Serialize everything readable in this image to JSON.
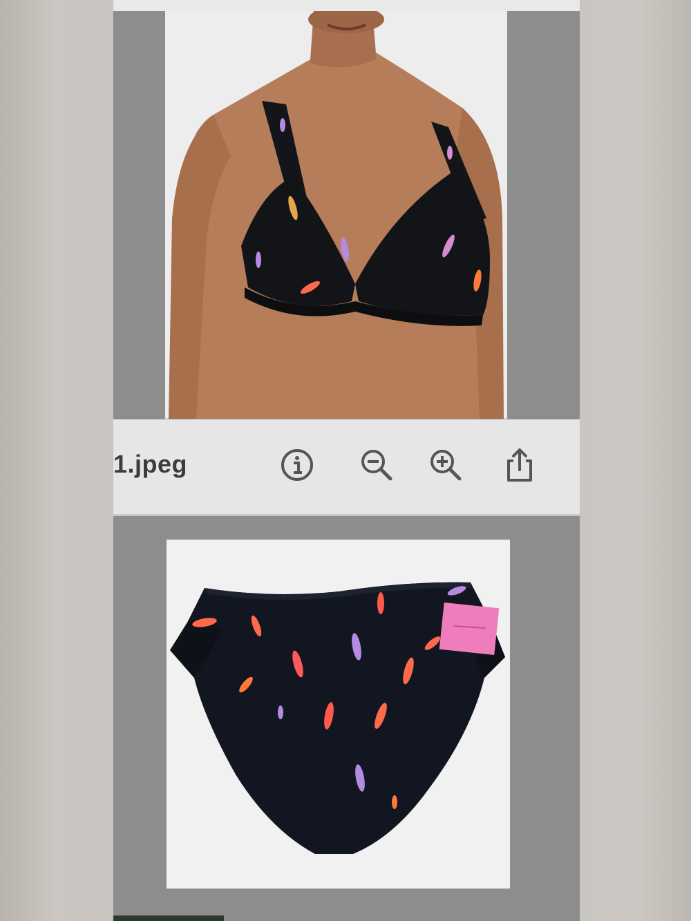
{
  "viewer": {
    "filename": "1.jpeg",
    "toolbar_icons": [
      "info-icon",
      "zoom-out-icon",
      "zoom-in-icon",
      "share-icon"
    ]
  },
  "images": {
    "top": "bikini-top-photo",
    "bottom": "bikini-bottom-photo"
  },
  "colors": {
    "toolbar_bg": "#e6e6e6",
    "viewer_bg": "#8d8d8d",
    "icon": "#555555",
    "swimsuit": "#121418",
    "tag": "#f07dbb"
  }
}
